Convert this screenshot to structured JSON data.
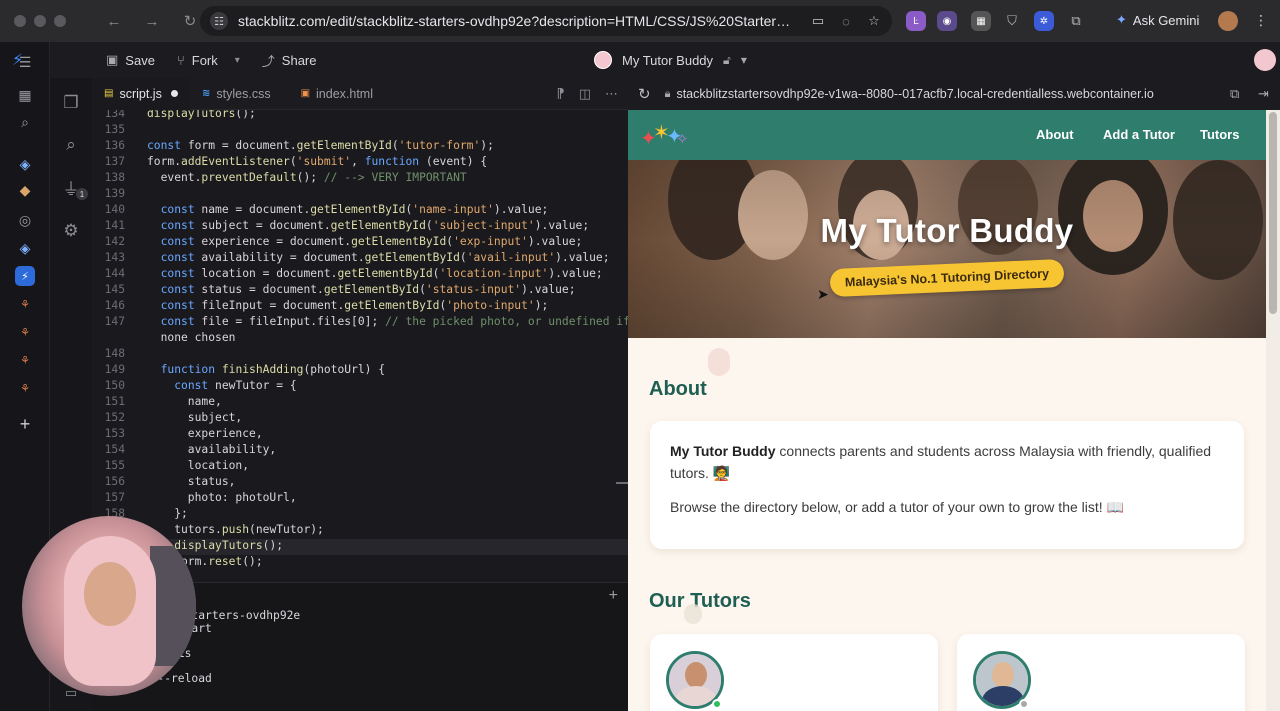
{
  "browser": {
    "url": "stackblitz.com/edit/stackblitz-starters-ovdhp92e?description=HTML/CSS/JS%20Starter&file...",
    "gemini_label": "Ask Gemini"
  },
  "toolbar": {
    "save_label": "Save",
    "fork_label": "Fork",
    "share_label": "Share",
    "project_title": "My Tutor Buddy"
  },
  "editor": {
    "tabs": [
      {
        "label": "script.js",
        "icon": "JS",
        "color": "#f0d34a"
      },
      {
        "label": "styles.css",
        "icon": "#",
        "color": "#4a9cf0"
      },
      {
        "label": "index.html",
        "icon": "5",
        "color": "#f0904a"
      }
    ],
    "code_lines": [
      {
        "n": "134",
        "text": "displayTutors();"
      },
      {
        "n": "135",
        "text": ""
      },
      {
        "n": "136",
        "text": "const form = document.getElementById('tutor-form');"
      },
      {
        "n": "137",
        "text": "form.addEventListener('submit', function (event) {"
      },
      {
        "n": "138",
        "text": "  event.preventDefault(); // --> VERY IMPORTANT"
      },
      {
        "n": "139",
        "text": ""
      },
      {
        "n": "140",
        "text": "  const name = document.getElementById('name-input').value;"
      },
      {
        "n": "141",
        "text": "  const subject = document.getElementById('subject-input').value;"
      },
      {
        "n": "142",
        "text": "  const experience = document.getElementById('exp-input').value;"
      },
      {
        "n": "143",
        "text": "  const availability = document.getElementById('avail-input').value;"
      },
      {
        "n": "144",
        "text": "  const location = document.getElementById('location-input').value;"
      },
      {
        "n": "145",
        "text": "  const status = document.getElementById('status-input').value;"
      },
      {
        "n": "146",
        "text": "  const fileInput = document.getElementById('photo-input');"
      },
      {
        "n": "147",
        "text": "  const file = fileInput.files[0]; // the picked photo, or undefined if"
      },
      {
        "n": "",
        "text": "  none chosen"
      },
      {
        "n": "148",
        "text": ""
      },
      {
        "n": "149",
        "text": "  function finishAdding(photoUrl) {"
      },
      {
        "n": "150",
        "text": "    const newTutor = {"
      },
      {
        "n": "151",
        "text": "      name,"
      },
      {
        "n": "152",
        "text": "      subject,"
      },
      {
        "n": "153",
        "text": "      experience,"
      },
      {
        "n": "154",
        "text": "      availability,"
      },
      {
        "n": "155",
        "text": "      location,"
      },
      {
        "n": "156",
        "text": "      status,"
      },
      {
        "n": "157",
        "text": "      photo: photoUrl,"
      },
      {
        "n": "158",
        "text": "    };"
      },
      {
        "n": "",
        "text": "    tutors.push(newTutor);"
      },
      {
        "n": "",
        "text": "    displayTutors();"
      },
      {
        "n": "",
        "text": "    form.reset();"
      }
    ],
    "terminal_lines": [
      "kblitz-starters-ovdhp92e",
      "& npm start",
      "",
      "ge in 1s",
      "",
      "or --reload"
    ]
  },
  "preview": {
    "url": "stackblitzstartersovdhp92e-v1wa--8080--017acfb7.local-credentialless.webcontainer.io",
    "nav": [
      "About",
      "Add a Tutor",
      "Tutors"
    ],
    "hero_title": "My Tutor Buddy",
    "hero_tagline": "Malaysia's No.1 Tutoring Directory",
    "about_heading": "About",
    "about_brand": "My Tutor Buddy",
    "about_p1_rest": " connects parents and students across Malaysia with friendly, qualified tutors. 🧑‍🏫",
    "about_p2": "Browse the directory below, or add a tutor of your own to grow the list! 📖",
    "tutors_heading": "Our Tutors",
    "tutor_status": [
      "online",
      "offline"
    ]
  },
  "colors": {
    "nav_green": "#2e7d6d",
    "heading_green": "#1f5e52",
    "pill_yellow": "#f7c531",
    "page_bg": "#fdf6ef"
  }
}
